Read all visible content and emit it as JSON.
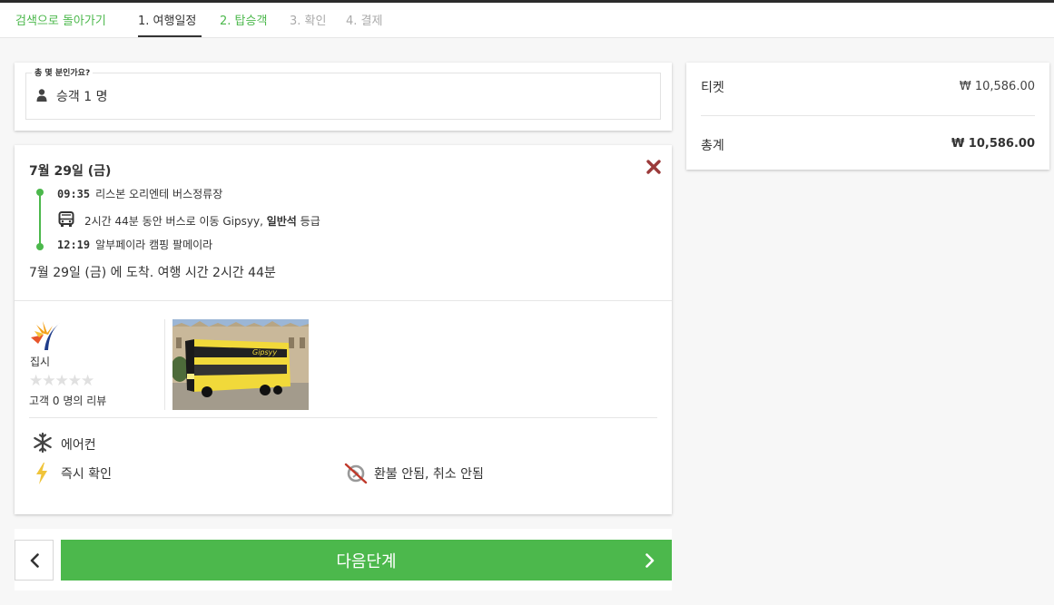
{
  "steps": {
    "back": "검색으로 돌아가기",
    "items": [
      {
        "label": "1. 여행일정",
        "state": "active"
      },
      {
        "label": "2. 탑승객",
        "state": "link"
      },
      {
        "label": "3. 확인",
        "state": "disabled"
      },
      {
        "label": "4. 결제",
        "state": "disabled"
      }
    ]
  },
  "passengers": {
    "legend": "총 몇 분인가요?",
    "value": "승객 1 명",
    "icon": "person-icon"
  },
  "summary": {
    "ticket_label": "티켓",
    "ticket_price": "₩ 10,586.00",
    "total_label": "총계",
    "total_price": "₩ 10,586.00"
  },
  "trip": {
    "date": "7월 29일 (금)",
    "departure_time": "09:35",
    "departure_place": "리스본 오리엔테 버스정류장",
    "travel_text_prefix": "2시간 44분 동안 버스로 이동 Gipsyy, ",
    "travel_class": "일반석",
    "travel_text_suffix": " 등급",
    "arrival_time": "12:19",
    "arrival_place": "알부페이라 캠핑 팔메이라",
    "arrival_summary": "7월 29일 (금) 에 도착. 여행 시간 2시간 44분",
    "operator": "집시",
    "rating_stars": 0,
    "reviews": "고객 0 명의 리뷰",
    "features": {
      "aircon": "에어컨",
      "instant": "즉시 확인",
      "refund": "환불 안됨, 취소 안됨"
    }
  },
  "nav": {
    "next_label": "다음단계"
  },
  "colors": {
    "accent_green": "#4cb84c",
    "close_red": "#9b3a3a",
    "bolt_yellow": "#f0c43a"
  }
}
